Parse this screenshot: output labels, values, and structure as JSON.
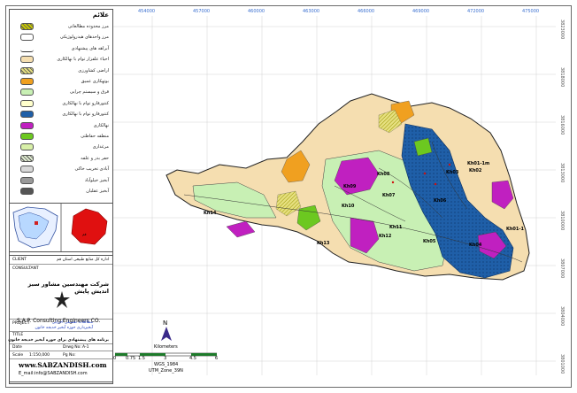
{
  "legend": {
    "title": "علائم",
    "items": [
      {
        "label": "مرز محدوده مطالعاتی",
        "color": "#c8c800",
        "kind": "hatched"
      },
      {
        "label": "مرز واحدهای هیدرولوژیکی",
        "color": "#ffffff",
        "kind": "outline"
      },
      {
        "label": "آبراهه های پیشنهادی",
        "color": "#ffffff",
        "kind": "line"
      },
      {
        "label": "احیاء علفزار توام با نهالکاری",
        "color": "#f5deb0",
        "kind": "fill"
      },
      {
        "label": "اراضی کشاورزی",
        "color": "#e6e080",
        "kind": "hatched"
      },
      {
        "label": "بوتهکاری عمیق",
        "color": "#f0a020",
        "kind": "fill"
      },
      {
        "label": "قرق و سیستم چرایی",
        "color": "#c8f0b4",
        "kind": "fill"
      },
      {
        "label": "کنتورفارو توام با نهالکاری",
        "color": "#ffffcc",
        "kind": "fill"
      },
      {
        "label": "کنتورفارو توام با نهالکاری",
        "color": "#1f5fa8",
        "kind": "fill"
      },
      {
        "label": "نهالکاری",
        "color": "#c020c0",
        "kind": "fill"
      },
      {
        "label": "منطقه حفاظتی",
        "color": "#6cc820",
        "kind": "fill"
      },
      {
        "label": "مرغداری",
        "color": "#d8f0a8",
        "kind": "fill"
      },
      {
        "label": "حفر بذر و علفه",
        "color": "#e0ecd0",
        "kind": "hatched"
      },
      {
        "label": "آبادی تخریب خاکی",
        "color": "#d8d8d8",
        "kind": "fill"
      },
      {
        "label": "آبخیز خیلوآباد",
        "color": "#9a9a9a",
        "kind": "fill"
      },
      {
        "label": "آبخیز عقلیان",
        "color": "#555555",
        "kind": "fill"
      }
    ]
  },
  "title_block": {
    "client_fa": "اداره کل منابع طبیعی استان قم",
    "client_en": "CLIENT",
    "consultant_en": "CONSULTANT",
    "company_fa": "شرکت مهندسین مشاور سبز اندیش پایش",
    "company_en": "S.A.P. Consulting Engineers CO.",
    "project_en": "PROJECT",
    "project_fa": "مطالعات تفصیلی اجرایی",
    "project_fa2": "آبخیزداری حوزه آبخیز خدیجه خاتون",
    "title_en": "TITLE",
    "title_fa": "برنامه های پیشنهادی برای حوزه آبخیز خدیجه خاتون",
    "date_en": "Date",
    "drwg_en": "Drwg No:",
    "drwg_val": "A-1",
    "scale_en": "Scale",
    "scale_val": "1:150,000",
    "pg_en": "Pg No:",
    "website": "www.SABZANDISH.com",
    "email": "E_mail:info@SABZANDISH.com"
  },
  "map": {
    "top_coords": [
      "454000",
      "457000",
      "460000",
      "463000",
      "466000",
      "469000",
      "472000",
      "475000",
      "478000"
    ],
    "right_coords": [
      "3823000",
      "3818000",
      "3816000",
      "3813000",
      "3810000",
      "3807000",
      "3804000",
      "3801000"
    ],
    "subbasins": [
      "Kh14",
      "Kh13",
      "Kh12",
      "Kh11",
      "Kh10",
      "Kh09",
      "Kh08",
      "Kh07",
      "Kh06",
      "Kh05",
      "Kh04",
      "Kh03",
      "Kh02",
      "Kh01-1",
      "Kh01-1m"
    ],
    "scale_labels": [
      "0",
      "0.75",
      "1.5",
      "3",
      "4.5",
      "6"
    ],
    "scale_unit": "Kilometers",
    "north": "N",
    "datum": "WGS_1984",
    "zone": "UTM_Zone_39N"
  }
}
